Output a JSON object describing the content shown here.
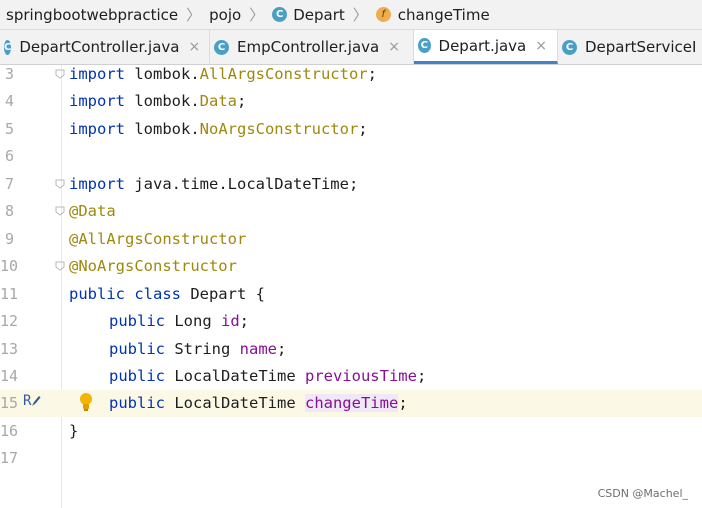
{
  "breadcrumb": [
    {
      "label": "springbootwebpractice",
      "icon": ""
    },
    {
      "label": "pojo",
      "icon": ""
    },
    {
      "label": "Depart",
      "icon": "class-icon"
    },
    {
      "label": "changeTime",
      "icon": "field-icon"
    }
  ],
  "tabs": [
    {
      "label": "DepartController.java",
      "active": false
    },
    {
      "label": "EmpController.java",
      "active": false
    },
    {
      "label": "Depart.java",
      "active": true
    },
    {
      "label": "DepartServiceI",
      "active": false
    }
  ],
  "icons": {
    "class": "C",
    "field": "f",
    "close": "×"
  },
  "editor": {
    "lines": [
      {
        "n": "3",
        "text": "import lombok.AllArgsConstructor;"
      },
      {
        "n": "4",
        "text": "import lombok.Data;"
      },
      {
        "n": "5",
        "text": "import lombok.NoArgsConstructor;"
      },
      {
        "n": "6",
        "text": ""
      },
      {
        "n": "7",
        "text": "import java.time.LocalDateTime;"
      },
      {
        "n": "8",
        "text": "@Data"
      },
      {
        "n": "9",
        "text": "@AllArgsConstructor"
      },
      {
        "n": "10",
        "text": "@NoArgsConstructor"
      },
      {
        "n": "11",
        "text": "public class Depart {"
      },
      {
        "n": "12",
        "text": "public Long id;"
      },
      {
        "n": "13",
        "text": "public String name;"
      },
      {
        "n": "14",
        "text": "public LocalDateTime previousTime;"
      },
      {
        "n": "15",
        "text": "public LocalDateTime changeTime;"
      },
      {
        "n": "16",
        "text": "}"
      },
      {
        "n": "17",
        "text": ""
      }
    ],
    "current_line": "15",
    "gutter_marker": "R"
  },
  "colors": {
    "keyword": "#0033b3",
    "annotation": "#9e880d",
    "field": "#871094",
    "tab_underline": "#4083c9"
  },
  "watermark": "CSDN @Machel_"
}
